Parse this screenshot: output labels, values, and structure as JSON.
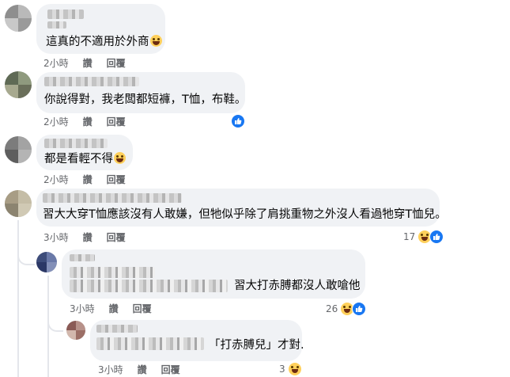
{
  "comments": [
    {
      "text": "這真的不適用於外商",
      "time": "2小時",
      "like": "讚",
      "reply": "回覆",
      "reaction_count": ""
    },
    {
      "text": "你說得對，我老闆都短褲，T恤，布鞋。",
      "time": "2小時",
      "like": "讚",
      "reply": "回覆",
      "reaction_count": ""
    },
    {
      "text": "都是看輕不得",
      "time": "2小時",
      "like": "讚",
      "reply": "回覆",
      "reaction_count": ""
    },
    {
      "text": "習大大穿T恤應該沒有人敢嫌，但牠似乎除了肩挑重物之外沒人看過牠穿T恤兒。",
      "time": "3小時",
      "like": "讚",
      "reply": "回覆",
      "reaction_count": "17"
    }
  ],
  "replies": [
    {
      "text": "習大打赤膊都沒人敢嗆他",
      "time": "3小時",
      "like": "讚",
      "reply": "回覆",
      "reaction_count": "26"
    },
    {
      "text": "「打赤膊兒」才對.",
      "time": "3小時",
      "like": "讚",
      "reply": "回覆",
      "reaction_count": "3"
    }
  ],
  "colors": {
    "bubble": "#f0f2f5",
    "meta_text": "#65676b",
    "like_blue": "#1877f2",
    "haha_yellow": "#ffd05b"
  },
  "icons": [
    "haha-emoji-icon",
    "like-reaction-icon",
    "haha-reaction-icon"
  ]
}
